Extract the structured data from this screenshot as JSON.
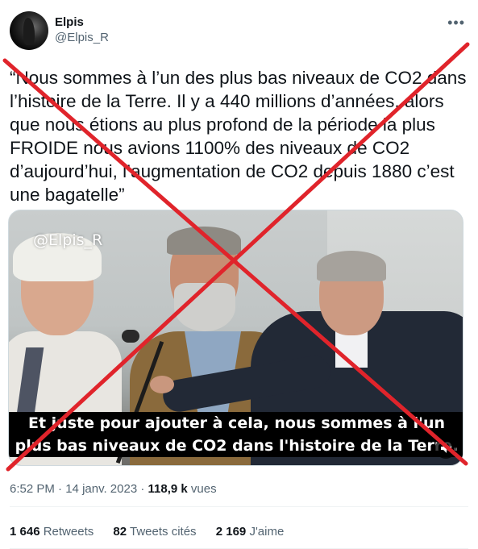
{
  "author": {
    "display_name": "Elpis",
    "handle": "@Elpis_R"
  },
  "tweet": {
    "text": "“Nous sommes à l’un des plus bas niveaux de CO2 dans l’histoire de la Terre. Il y a 440 millions d’années, alors que nous étions au plus profond de la période la plus FROIDE nous avions 1100% des niveaux de CO2 d’aujourd’hui, l’augmentation de CO2 depuis 1880 c’est une bagatelle”"
  },
  "media": {
    "watermark": "@Elpis_R",
    "caption_line1": "Et juste pour ajouter à cela, nous sommes à l'un des",
    "caption_line2": "plus bas niveaux de CO2 dans l'histoire de la Terre.",
    "cross_color": "#e0242b"
  },
  "meta": {
    "time": "6:52 PM",
    "separator": " · ",
    "date": "14 janv. 2023",
    "views_count": "118,9 k",
    "views_label": "vues"
  },
  "stats": {
    "retweets_count": "1 646",
    "retweets_label": "Retweets",
    "quotes_count": "82",
    "quotes_label": "Tweets cités",
    "likes_count": "2 169",
    "likes_label": "J'aime"
  },
  "icons": {
    "more": "more-options-icon",
    "mute": "volume-mute-icon"
  }
}
